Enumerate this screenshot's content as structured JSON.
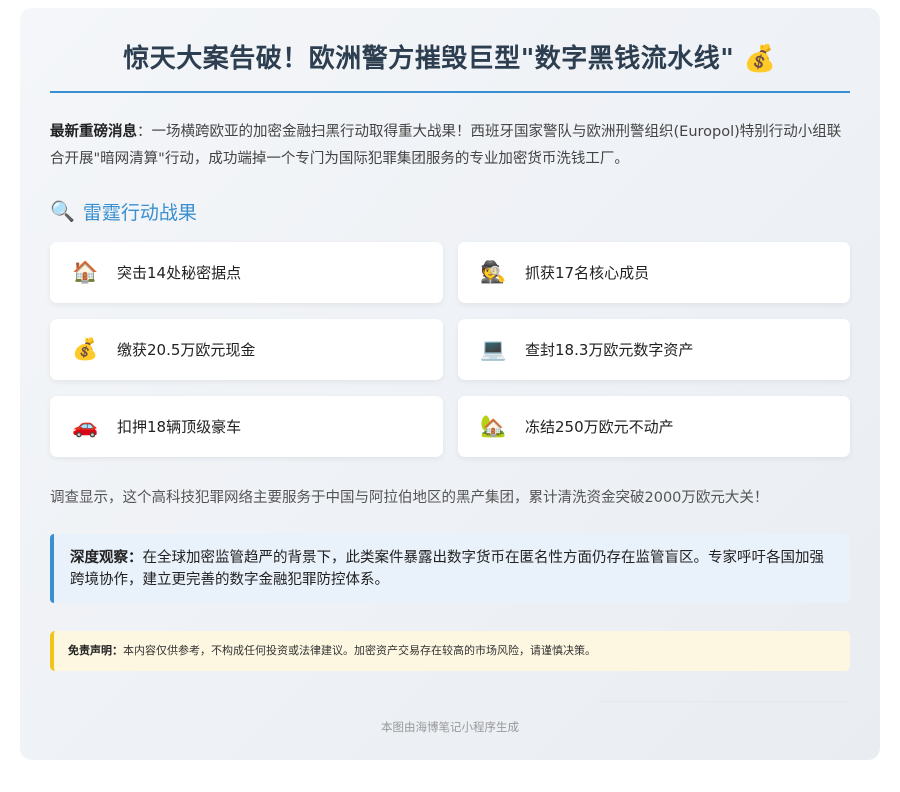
{
  "title": "惊天大案告破！欧洲警方摧毁巨型\"数字黑钱流水线\"",
  "title_icon": "money-bag-icon",
  "intro": {
    "lead": "最新重磅消息",
    "text": "：一场横跨欧亚的加密金融扫黑行动取得重大战果！西班牙国家警队与欧洲刑警组织(Europol)特别行动小组联合开展\"暗网清算\"行动，成功端掉一个专门为国际犯罪集团服务的专业加密货币洗钱工厂。"
  },
  "section": {
    "icon": "magnifier-icon",
    "title": "雷霆行动战果"
  },
  "stats": [
    {
      "icon": "house-icon",
      "glyph": "🏠",
      "label": "突击14处秘密据点"
    },
    {
      "icon": "detective-icon",
      "glyph": "🕵",
      "label": "抓获17名核心成员"
    },
    {
      "icon": "money-bag-icon",
      "glyph": "💰",
      "label": "缴获20.5万欧元现金"
    },
    {
      "icon": "laptop-icon",
      "glyph": "💻",
      "label": "查封18.3万欧元数字资产"
    },
    {
      "icon": "car-icon",
      "glyph": "🚗",
      "label": "扣押18辆顶级豪车"
    },
    {
      "icon": "house-garden-icon",
      "glyph": "🏡",
      "label": "冻结250万欧元不动产"
    }
  ],
  "summary": "调查显示，这个高科技犯罪网络主要服务于中国与阿拉伯地区的黑产集团，累计清洗资金突破2000万欧元大关！",
  "insight": {
    "lead": "深度观察：",
    "text": "在全球加密监管趋严的背景下，此类案件暴露出数字货币在匿名性方面仍存在监管盲区。专家呼吁各国加强跨境协作，建立更完善的数字金融犯罪防控体系。"
  },
  "disclaimer": {
    "lead": "免责声明：",
    "text": "本内容仅供参考，不构成任何投资或法律建议。加密资产交易存在较高的市场风险，请谨慎决策。"
  },
  "footer": "本图由海博笔记小程序生成",
  "colors": {
    "accent": "#3a8fd0",
    "title": "#2c3e50",
    "warning": "#f0c419"
  }
}
